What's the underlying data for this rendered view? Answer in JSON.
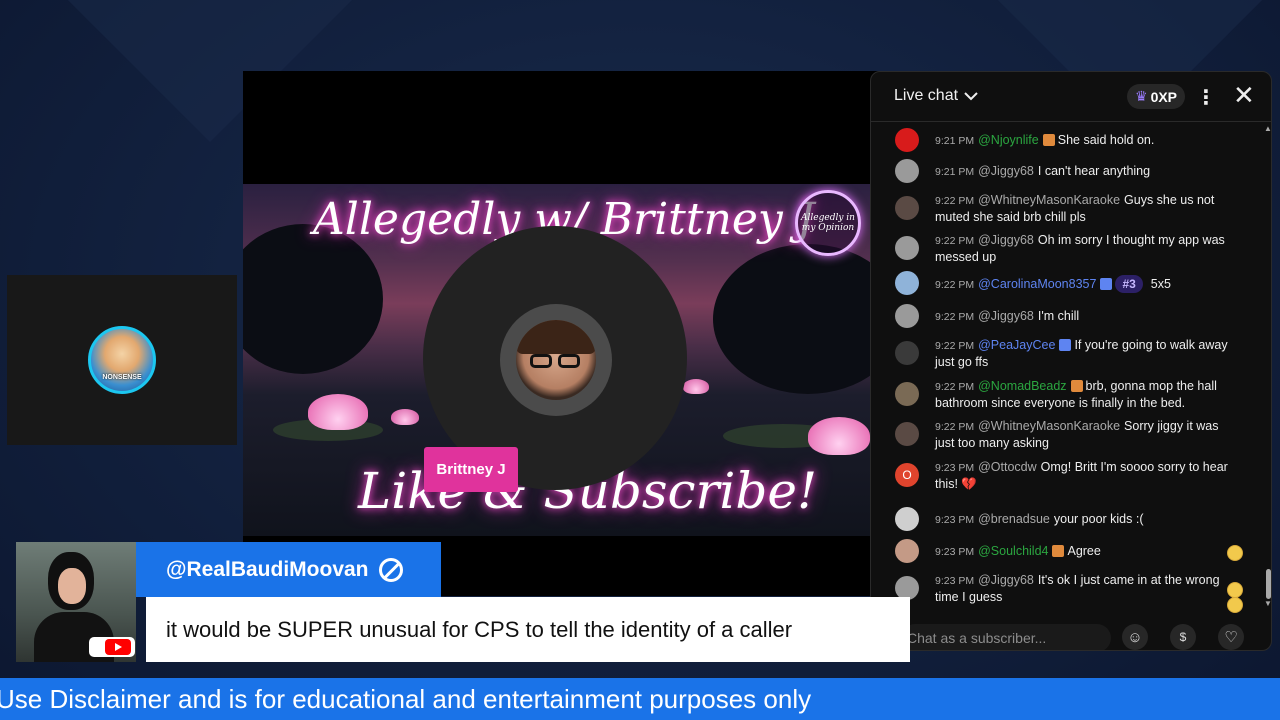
{
  "stream": {
    "thumbnail_title": "Allegedly w/ Brittney J",
    "thumbnail_cta": "Like & Subscribe!",
    "thumbnail_badge": "Allegedly in my Opinion",
    "speaker_name": "Brittney J",
    "side_tile_label": "NONSENSE"
  },
  "chat": {
    "title": "Live chat",
    "xp": "0XP",
    "input_placeholder": "Chat as a subscriber...",
    "messages": [
      {
        "time": "9:21 PM",
        "author": "@Njoynlife",
        "author_style": "member",
        "text": "She said hold on.",
        "avatar_color": "#d81b1b"
      },
      {
        "time": "9:21 PM",
        "author": "@Jiggy68",
        "author_style": "normal",
        "text": "I can't hear anything",
        "avatar_color": "#9a9a9a"
      },
      {
        "time": "9:22 PM",
        "author": "@WhitneyMasonKaraoke",
        "author_style": "normal",
        "text": "Guys she us not muted she said brb chill pls",
        "avatar_color": "#5a4a44"
      },
      {
        "time": "9:22 PM",
        "author": "@Jiggy68",
        "author_style": "normal",
        "text": "Oh im sorry I thought my app was messed up",
        "avatar_color": "#9a9a9a"
      },
      {
        "time": "9:22 PM",
        "author": "@CarolinaMoon8357",
        "author_style": "mod",
        "rank": "#3",
        "text": "5x5",
        "avatar_color": "#8fb3d9"
      },
      {
        "time": "9:22 PM",
        "author": "@Jiggy68",
        "author_style": "normal",
        "text": "I'm chill",
        "avatar_color": "#9a9a9a"
      },
      {
        "time": "9:22 PM",
        "author": "@PeaJayCee",
        "author_style": "mod",
        "text": "If you're going to walk away just go ffs",
        "avatar_color": "#3a3a3a"
      },
      {
        "time": "9:22 PM",
        "author": "@NomadBeadz",
        "author_style": "member",
        "text": "brb, gonna mop the hall bathroom since everyone is finally in the bed.",
        "avatar_color": "#7a6a55"
      },
      {
        "time": "9:22 PM",
        "author": "@WhitneyMasonKaraoke",
        "author_style": "normal",
        "text": "Sorry jiggy it was just too many asking",
        "avatar_color": "#5a4a44"
      },
      {
        "time": "9:23 PM",
        "author": "@Ottocdw",
        "author_style": "normal",
        "text": "Omg! Britt I'm soooo sorry to hear this! 💔",
        "avatar_color": "#e0442d",
        "avatar_letter": "O"
      },
      {
        "time": "9:23 PM",
        "author": "@brenadsue",
        "author_style": "normal",
        "text": "your poor kids :(",
        "avatar_color": "#cfcfcf"
      },
      {
        "time": "9:23 PM",
        "author": "@Soulchild4",
        "author_style": "member",
        "text": "Agree",
        "avatar_color": "#c49a86"
      },
      {
        "time": "9:23 PM",
        "author": "@Jiggy68",
        "author_style": "normal",
        "text": "It's ok I just came in at the wrong time I guess",
        "avatar_color": "#9a9a9a"
      }
    ]
  },
  "comment": {
    "handle": "@RealBaudiMoovan",
    "text": "it would be SUPER unusual for CPS to tell the identity of a caller"
  },
  "ticker": {
    "text": "Use Disclaimer and is for educational and entertainment purposes only"
  },
  "colors": {
    "accent_blue": "#1a73e8",
    "speaker_pink": "#e0339c",
    "member_green": "#2ba640",
    "mod_blue": "#5e84f1"
  },
  "icons": [
    "chevron-down-icon",
    "crown-icon",
    "more-vert-icon",
    "close-icon",
    "emoji-icon",
    "super-chat-icon",
    "heart-icon",
    "ban-icon",
    "youtube-logo"
  ]
}
